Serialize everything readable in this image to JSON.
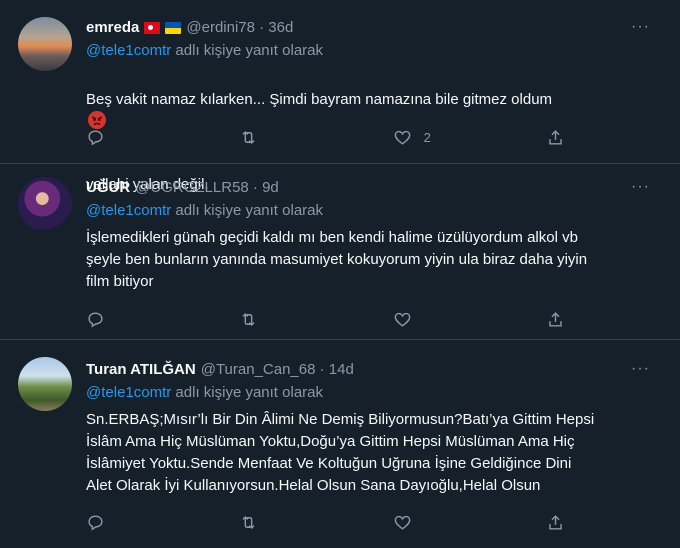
{
  "tweets": [
    {
      "name": "emreda",
      "flags": [
        "turkey-flag",
        "ukraine-flag"
      ],
      "handle": "@erdini78 · 36d",
      "reply_mention": "@tele1comtr",
      "reply_suffix": " adlı kişiye yanıt olarak",
      "text": "Beş vakit namaz kılarken... Şimdi bayram namazına bile gitmez oldum",
      "text_line2": "vallahi yalan değil.",
      "emoji": "angry-face-emoji",
      "like_count": "2",
      "menu": "···"
    },
    {
      "name": "UĞUR",
      "handle": "@UGRGZLLR58 · 9d",
      "reply_mention": "@tele1comtr",
      "reply_suffix": " adlı kişiye yanıt olarak",
      "text": "İşlemedikleri günah geçidi kaldı mı ben kendi halime üzülüyordum alkol vb\nşeyle ben bunların yanında masumiyet kokuyorum yiyin ula biraz daha yiyin\nfilm bitiyor",
      "menu": "···"
    },
    {
      "name": "Turan ATILĞAN",
      "handle": "@Turan_Can_68 · 14d",
      "reply_mention": "@tele1comtr",
      "reply_suffix": " adlı kişiye yanıt olarak",
      "text": "Sn.ERBAŞ;Mısır’lı Bir Din Âlimi Ne Demiş Biliyormusun?Batı’ya Gittim Hepsi\nİslâm Ama Hiç Müslüman Yoktu,Doğu’ya Gittim Hepsi Müslüman Ama Hiç\nİslâmiyet Yoktu.Sende Menfaat Ve Koltuğun Uğruna İşine Geldiğince Dini\nAlet Olarak İyi Kullanıyorsun.Helal Olsun Sana Dayıoğlu,Helal Olsun",
      "menu": "···"
    }
  ],
  "colors": {
    "background": "#15202b",
    "secondary_text": "#8b98a5",
    "accent": "#1d9bf0"
  }
}
